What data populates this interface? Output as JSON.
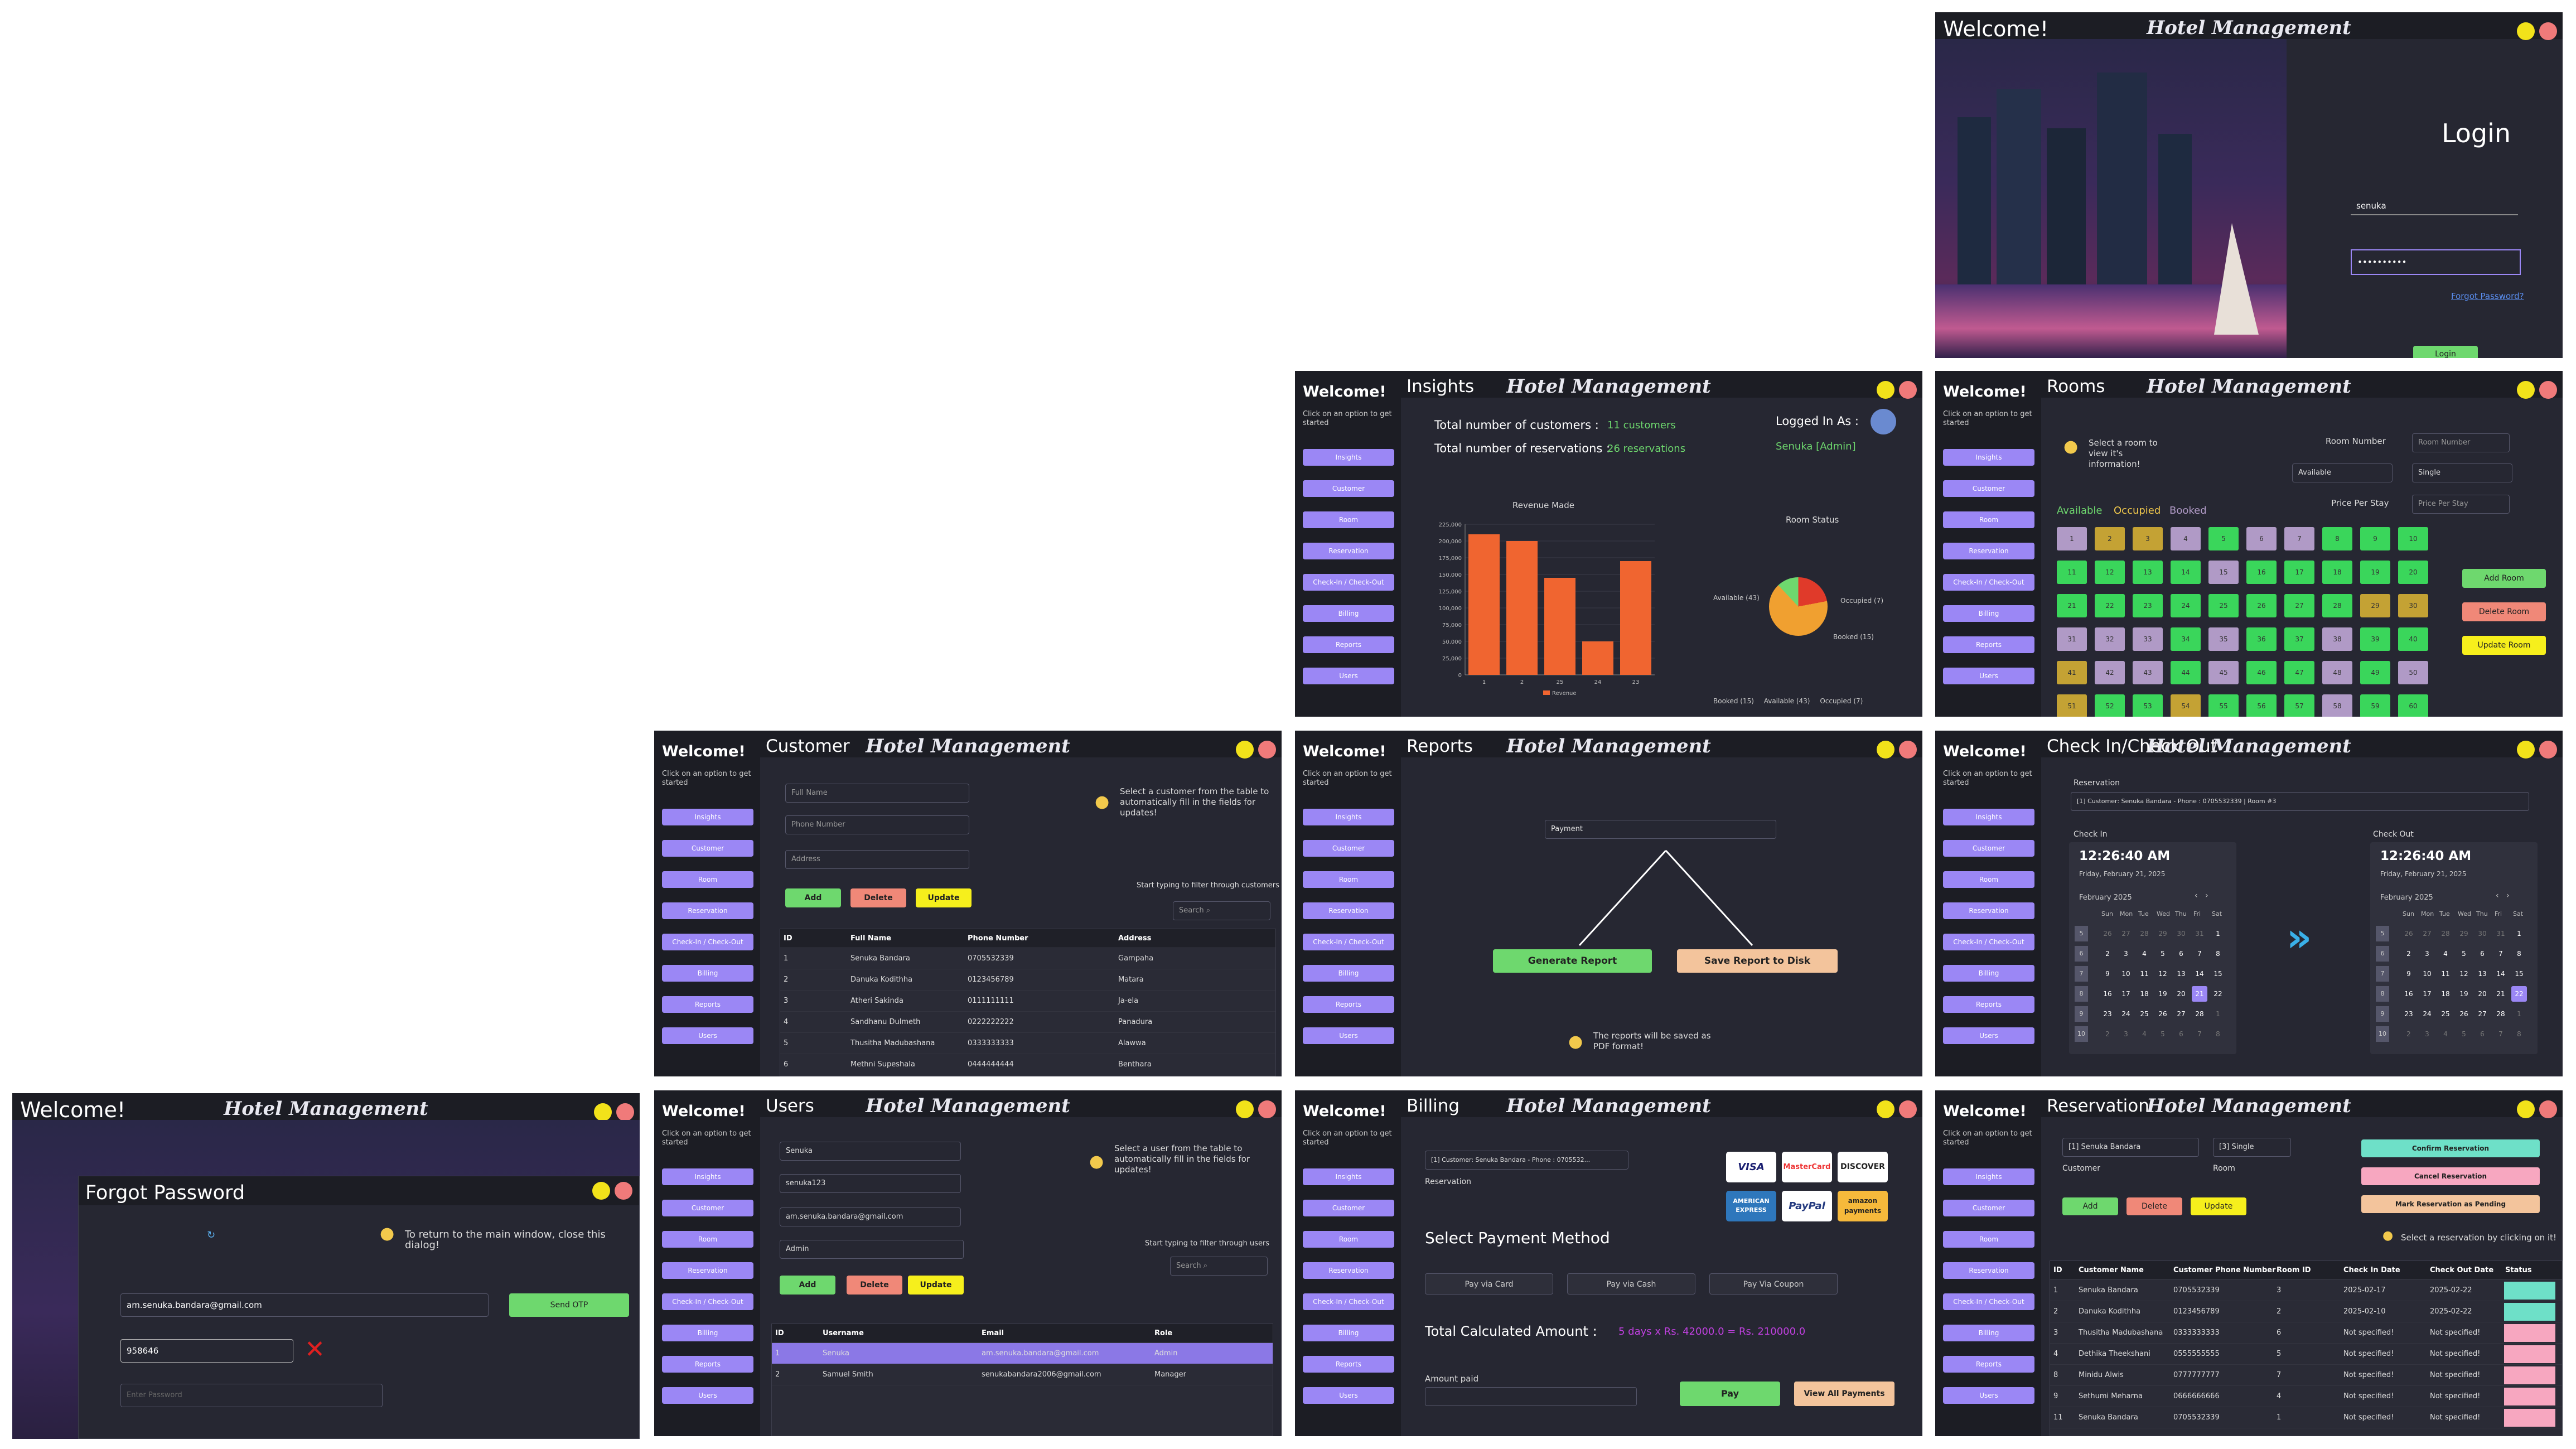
{
  "app_title": "Hotel Management",
  "welcome": "Welcome!",
  "hint": "Click on an option to get started",
  "nav": [
    "Insights",
    "Customer",
    "Room",
    "Reservation",
    "Check-In / Check-Out",
    "Billing",
    "Reports",
    "Users"
  ],
  "login": {
    "title": "Login",
    "username": "senuka",
    "password": "••••••••••",
    "forgot": "Forgot Password?",
    "button": "Login"
  },
  "insights": {
    "section": "Insights",
    "cust_label": "Total number of customers :",
    "cust_value": "11 customers",
    "res_label": "Total number of reservations :",
    "res_value": "26 reservations",
    "logged_label": "Logged In As :",
    "logged_value": "Senuka [Admin]",
    "rev_title": "Revenue Made",
    "room_title": "Room Status",
    "pie_available": "Available (43)",
    "pie_occupied": "Occupied (7)",
    "pie_booked": "Booked (15)",
    "legend_booked": "Booked (15)",
    "legend_available": "Available (43)",
    "legend_occupied": "Occupied (7)",
    "legend_revenue": "Revenue"
  },
  "chart_data": {
    "type": "bar",
    "title": "Revenue Made",
    "categories": [
      "1",
      "2",
      "25",
      "24",
      "23"
    ],
    "values": [
      210000,
      200000,
      145000,
      50000,
      170000
    ],
    "ylim": [
      0,
      225000
    ],
    "yticks": [
      "225,000",
      "200,000",
      "175,000",
      "150,000",
      "125,000",
      "100,000",
      "75,000",
      "50,000",
      "25,000",
      "0"
    ],
    "series": [
      {
        "name": "Revenue"
      }
    ],
    "colors": [
      "#f06530"
    ]
  },
  "rooms": {
    "section": "Rooms",
    "tip": "Select a room to view it's information!",
    "number_label": "Room Number",
    "number_ph": "Room Number",
    "status_sel": "Available",
    "type_sel": "Single",
    "price_label": "Price Per Stay",
    "price_ph": "Price Per Stay",
    "legend_a": "Available",
    "legend_o": "Occupied",
    "legend_b": "Booked",
    "add": "Add Room",
    "delete": "Delete Room",
    "update": "Update Room",
    "statuses": [
      "b",
      "o",
      "o",
      "b",
      "a",
      "b",
      "b",
      "a",
      "a",
      "a",
      "a",
      "a",
      "a",
      "a",
      "b",
      "a",
      "a",
      "a",
      "a",
      "a",
      "a",
      "a",
      "a",
      "a",
      "a",
      "a",
      "a",
      "a",
      "o",
      "o",
      "b",
      "b",
      "b",
      "a",
      "b",
      "a",
      "a",
      "b",
      "a",
      "a",
      "o",
      "b",
      "b",
      "a",
      "b",
      "a",
      "a",
      "b",
      "a",
      "b",
      "o",
      "a",
      "a",
      "o",
      "a",
      "a",
      "a",
      "b",
      "a",
      "a"
    ]
  },
  "customer": {
    "section": "Customer",
    "ph_name": "Full Name",
    "ph_phone": "Phone Number",
    "ph_address": "Address",
    "add": "Add",
    "delete": "Delete",
    "update": "Update",
    "tip": "Select a customer from the table to automatically fill in the fields for updates!",
    "filter": "Start typing to filter through customers",
    "search": "Search ⌕",
    "headers": [
      "ID",
      "Full Name",
      "Phone Number",
      "Address"
    ],
    "rows": [
      [
        "1",
        "Senuka Bandara",
        "0705532339",
        "Gampaha"
      ],
      [
        "2",
        "Danuka Kodithha",
        "0123456789",
        "Matara"
      ],
      [
        "3",
        "Atheri Sakinda",
        "0111111111",
        "Ja-ela"
      ],
      [
        "4",
        "Sandhanu Dulmeth",
        "0222222222",
        "Panadura"
      ],
      [
        "5",
        "Thusitha Madubashana",
        "0333333333",
        "Alawwa"
      ],
      [
        "6",
        "Methni Supeshala",
        "0444444444",
        "Benthara"
      ]
    ]
  },
  "reports": {
    "section": "Reports",
    "select": "Payment",
    "gen": "Generate Report",
    "save": "Save Report to Disk",
    "tip": "The reports will be saved as PDF format!"
  },
  "checkin": {
    "section": "Check In/Check Out",
    "res_label": "Reservation",
    "res_value": "[1] Customer: Senuka Bandara - Phone : 0705532339 | Room #3",
    "in_label": "Check In",
    "out_label": "Check Out",
    "time": "12:26:40 AM",
    "date": "Friday, February 21, 2025",
    "month": "February 2025",
    "days": [
      "Sun",
      "Mon",
      "Tue",
      "Wed",
      "Thu",
      "Fri",
      "Sat"
    ],
    "weeks": [
      "5",
      "6",
      "7",
      "8",
      "9",
      "10"
    ],
    "grid": [
      [
        "26",
        "27",
        "28",
        "29",
        "30",
        "31",
        "1"
      ],
      [
        "2",
        "3",
        "4",
        "5",
        "6",
        "7",
        "8"
      ],
      [
        "9",
        "10",
        "11",
        "12",
        "13",
        "14",
        "15"
      ],
      [
        "16",
        "17",
        "18",
        "19",
        "20",
        "21",
        "22"
      ],
      [
        "23",
        "24",
        "25",
        "26",
        "27",
        "28",
        "1"
      ],
      [
        "2",
        "3",
        "4",
        "5",
        "6",
        "7",
        "8"
      ]
    ]
  },
  "forgot": {
    "title": "Forgot Password",
    "tip": "To return to the main window, close this dialog!",
    "email": "am.senuka.bandara@gmail.com",
    "otp_btn": "Send OTP",
    "otp": "958646",
    "pw_ph": "Enter Password"
  },
  "users": {
    "section": "Users",
    "name": "Senuka",
    "password": "senuka123",
    "email": "am.senuka.bandara@gmail.com",
    "role": "Admin",
    "add": "Add",
    "delete": "Delete",
    "update": "Update",
    "tip": "Select a user from the table to automatically fill in the fields for updates!",
    "filter": "Start typing to filter through users",
    "search": "Search ⌕",
    "headers": [
      "ID",
      "Username",
      "Email",
      "Role"
    ],
    "rows": [
      [
        "1",
        "Senuka",
        "am.senuka.bandara@gmail.com",
        "Admin"
      ],
      [
        "2",
        "Samuel Smith",
        "senukabandara2006@gmail.com",
        "Manager"
      ]
    ]
  },
  "billing": {
    "section": "Billing",
    "res_value": "[1] Customer: Senuka Bandara - Phone : 0705532...",
    "res_label": "Reservation",
    "method": "Select Payment Method",
    "card": "Pay via Card",
    "cash": "Pay via Cash",
    "coupon": "Pay Via Coupon",
    "total_label": "Total Calculated Amount :",
    "total_value": "5 days x Rs. 42000.0 = Rs. 210000.0",
    "paid_label": "Amount paid",
    "pay": "Pay",
    "view": "View All Payments",
    "cards": [
      "VISA",
      "MasterCard",
      "DISCOVER",
      "AMERICAN EXPRESS",
      "PayPal",
      "amazon payments"
    ]
  },
  "reservation": {
    "section": "Reservation",
    "customer_sel": "[1] Senuka Bandara",
    "room_sel": "[3] Single",
    "customer_label": "Customer",
    "room_label": "Room",
    "confirm": "Confirm Reservation",
    "cancel": "Cancel Reservation",
    "pending": "Mark Reservation as Pending",
    "add": "Add",
    "delete": "Delete",
    "update": "Update",
    "tip": "Select a reservation by clicking on it!",
    "headers": [
      "ID",
      "Customer Name",
      "Customer Phone Number",
      "Room ID",
      "Check In Date",
      "Check Out Date",
      "Status"
    ],
    "rows": [
      [
        "1",
        "Senuka Bandara",
        "0705532339",
        "3",
        "2025-02-17",
        "2025-02-22"
      ],
      [
        "2",
        "Danuka Kodithha",
        "0123456789",
        "2",
        "2025-02-10",
        "2025-02-22"
      ],
      [
        "3",
        "Thusitha Madubashana",
        "0333333333",
        "6",
        "Not specified!",
        "Not specified!"
      ],
      [
        "4",
        "Dethika Theekshani",
        "0555555555",
        "5",
        "Not specified!",
        "Not specified!"
      ],
      [
        "8",
        "Minidu Alwis",
        "0777777777",
        "7",
        "Not specified!",
        "Not specified!"
      ],
      [
        "9",
        "Sethumi Meharna",
        "0666666666",
        "4",
        "Not specified!",
        "Not specified!"
      ],
      [
        "11",
        "Senuka Bandara",
        "0705532339",
        "1",
        "Not specified!",
        "Not specified!"
      ]
    ]
  }
}
